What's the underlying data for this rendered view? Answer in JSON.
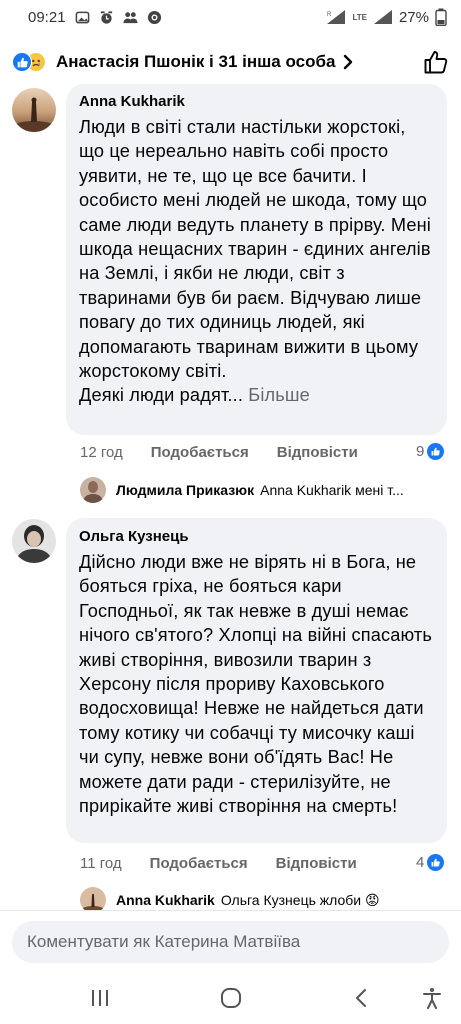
{
  "status_bar": {
    "time": "09:21",
    "battery": "27%",
    "network": "LTE"
  },
  "header": {
    "title": "Анастасія Пшонік і 31 інша особа",
    "reactions": [
      "like-icon",
      "sad-face-icon"
    ]
  },
  "comments": [
    {
      "author": "Anna Kukharik",
      "text": "Люди в світі стали настільки жорстокі, що це нереально навіть собі просто уявити, не те, що це все бачити. І особисто мені людей не шкода, тому що саме люди ведуть планету в прірву. Мені шкода нещасних тварин - єдиних ангелів на Землі, і якби не люди, світ з тваринами був би раєм. Відчуваю лише повагу до тих одиниць людей, які допомагають тваринам вижити в цьому жорстокому світі.",
      "text_last_line": "Деякі люди радят...",
      "more_label": "Більше",
      "time": "12 год",
      "like_label": "Подобається",
      "reply_label": "Відповісти",
      "reaction_count": "9"
    },
    {
      "author": "Ольга Кузнець",
      "text": "Дійсно люди вже не вірять ні в Бога, не бояться гріха, не бояться кари Господньої, як так невже в душі немає нічого св'ятого? Хлопці на війні спасають живі створіння, вивозили тварин з Херсону після прориву Каховського водосховища! Невже не найдеться дати тому котику чи собачці ту мисочку каші чи супу, невже вони об'їдять Вас! Не можете дати ради - стерилізуйте, не прирікайте живі створіння на смерть!",
      "time": "11 год",
      "like_label": "Подобається",
      "reply_label": "Відповісти",
      "reaction_count": "4"
    }
  ],
  "replies": [
    {
      "author": "Людмила Приказюк",
      "text": "Anna Kukharik мені т..."
    },
    {
      "author": "Anna Kukharik",
      "text": "Ольга Кузнець жлоби 😡"
    }
  ],
  "compose": {
    "placeholder": "Коментувати як Катерина Матвіїва"
  },
  "nav": [
    "recent-apps-icon",
    "home-icon",
    "back-icon",
    "accessibility-icon"
  ]
}
